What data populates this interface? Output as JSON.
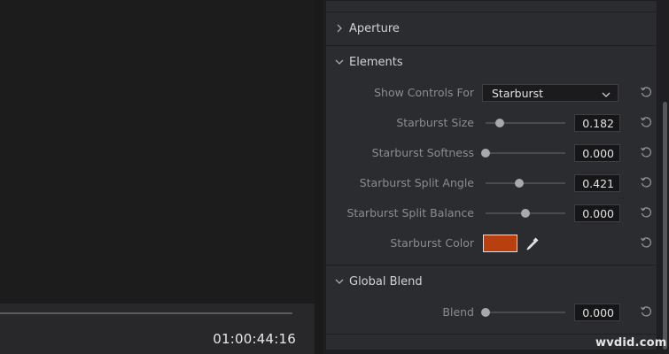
{
  "viewer": {
    "timecode": "01:00:44:16"
  },
  "inspector": {
    "sections": {
      "aperture": {
        "title": "Aperture",
        "expanded": false
      },
      "elements": {
        "title": "Elements",
        "expanded": true
      },
      "global_blend": {
        "title": "Global Blend",
        "expanded": true
      }
    },
    "show_controls": {
      "label": "Show Controls For",
      "selected": "Starburst"
    },
    "starburst_size": {
      "label": "Starburst Size",
      "value": "0.182",
      "slider_fraction": 0.182
    },
    "starburst_softness": {
      "label": "Starburst Softness",
      "value": "0.000",
      "slider_fraction": 0.0
    },
    "starburst_split_angle": {
      "label": "Starburst Split Angle",
      "value": "0.421",
      "slider_fraction": 0.421
    },
    "starburst_split_balance": {
      "label": "Starburst Split Balance",
      "value": "0.000",
      "slider_fraction": 0.5
    },
    "starburst_color": {
      "label": "Starburst Color",
      "color": "#b8400f"
    },
    "blend": {
      "label": "Blend",
      "value": "0.000",
      "slider_fraction": 0.0
    }
  },
  "colors": {
    "panel_bg": "#2b2c2f",
    "value_box_bg": "#161618",
    "label_text": "#8b8c8f",
    "accent_swatch": "#b8400f"
  },
  "watermark": "wvdid.com"
}
